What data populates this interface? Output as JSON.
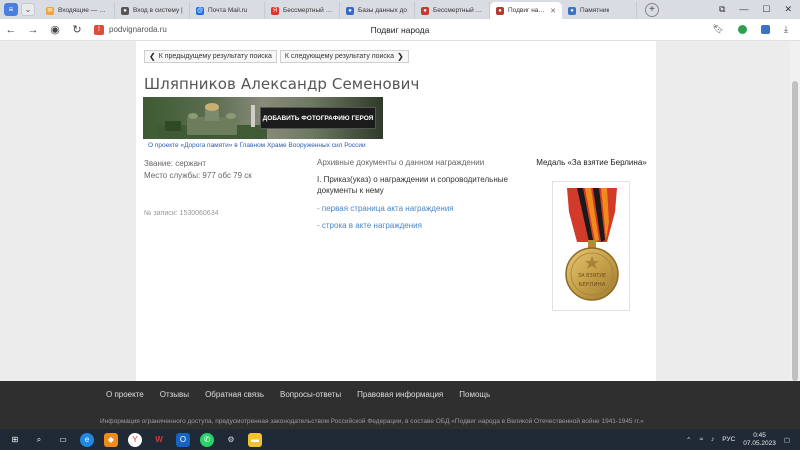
{
  "tabs": [
    {
      "label": "Входящие — Яндекс",
      "color": "#f2a33a",
      "glyph": "✉"
    },
    {
      "label": "Вход в систему |",
      "color": "#555555",
      "glyph": "●"
    },
    {
      "label": "Почта Mail.ru",
      "color": "#1b6ee0",
      "glyph": "@"
    },
    {
      "label": "Бессмертный пол",
      "color": "#e0332a",
      "glyph": "Я"
    },
    {
      "label": "Базы данных до",
      "color": "#3a6bc4",
      "glyph": "●"
    },
    {
      "label": "Бессмертный пол",
      "color": "#c53a2c",
      "glyph": "●"
    },
    {
      "label": "Подвиг народа",
      "color": "#b23a2e",
      "glyph": "●",
      "active": true
    },
    {
      "label": "Памятник",
      "color": "#3a72c4",
      "glyph": "●"
    }
  ],
  "address": {
    "url": "podvignaroda.ru",
    "page_title": "Подвиг народа"
  },
  "nav": {
    "prev": "К предыдущему результату поиска",
    "next": "К следующему результату поиска"
  },
  "hero": {
    "name": "Шляпников Александр Семенович",
    "add_photo": "ДОБАВИТЬ ФОТОГРАФИЮ ГЕРОЯ",
    "project_link": "О проекте «Дорога памяти» в Главном Храме Вооруженных сил России",
    "rank": "Звание: сержант",
    "unit": "Место службы: 977 обс 79 ск",
    "record_no": "№ записи: 1530060634"
  },
  "docs": {
    "header": "Архивные документы о данном награждении",
    "order": "I. Приказ(указ) о награждении и сопроводительные документы к нему",
    "link1": "- первая страница акта награждения",
    "link2": "- строка в акте награждения"
  },
  "medal": {
    "title": "Медаль «За взятие Берлина»",
    "inscription": "ЗА ВЗЯТИЕ БЕРЛИНА"
  },
  "footer": {
    "links": [
      "О проекте",
      "Отзывы",
      "Обратная связь",
      "Вопросы-ответы",
      "Правовая информация",
      "Помощь"
    ],
    "note": "Информация ограниченного доступа, предусмотренная законодательством Российской Федерации, в составе ОБД «Подвиг народа в Великой Отечественной войне 1941-1945 гг.»"
  },
  "taskbar": {
    "lang": "РУС",
    "time": "0:45",
    "date": "07.05.2023"
  }
}
